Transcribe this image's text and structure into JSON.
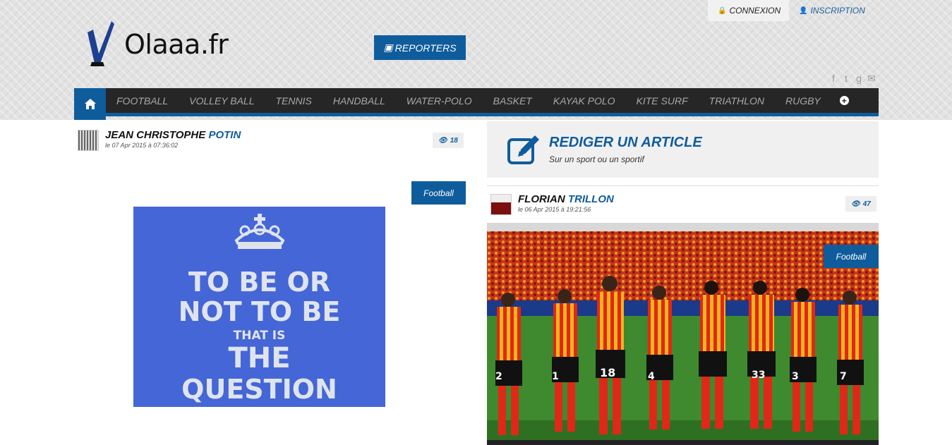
{
  "auth": {
    "login_label": "CONNEXION",
    "register_label": "INSCRIPTION"
  },
  "logo": {
    "text": "Olaaa.fr"
  },
  "reporters": {
    "label": "REPORTERS"
  },
  "social": [
    "facebook-icon",
    "twitter-icon",
    "google-plus-icon",
    "mail-icon"
  ],
  "nav": {
    "items": [
      "FOOTBALL",
      "VOLLEY BALL",
      "TENNIS",
      "HANDBALL",
      "WATER-POLO",
      "BASKET",
      "KAYAK POLO",
      "KITE SURF",
      "TRIATHLON",
      "RUGBY"
    ]
  },
  "post1": {
    "author_first": "JEAN CHRISTOPHE",
    "author_last": "POTIN",
    "date": "le 07 Apr 2015 à 07:36:02",
    "views": "18",
    "category": "Football",
    "image_lines": [
      "TO BE OR",
      "NOT TO BE",
      "THAT IS",
      "THE",
      "QUESTION"
    ]
  },
  "write_article": {
    "title": "REDIGER UN ARTICLE",
    "subtitle": "Sur un sport ou un sportif"
  },
  "post2": {
    "author_first": "FLORIAN",
    "author_last": "TRILLON",
    "date": "le 06 Apr 2015 à 19:21:56",
    "views": "47",
    "category": "Football",
    "jersey_numbers": [
      "2",
      "1",
      "18",
      "4",
      "33",
      "3",
      "7"
    ]
  },
  "colors": {
    "brand_blue": "#0f5c9c",
    "nav_dark": "#262626",
    "sign_blue": "#4466d6"
  }
}
